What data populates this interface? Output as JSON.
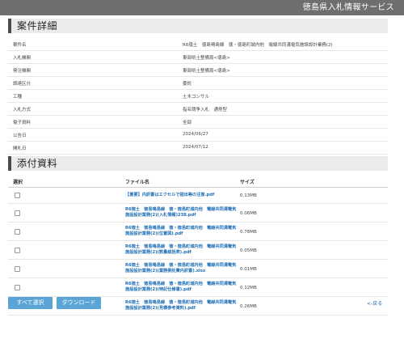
{
  "site": {
    "title": "徳島県入札情報サービス"
  },
  "details": {
    "heading": "案件詳細",
    "rows": [
      {
        "label": "案件名",
        "value": "R6徳土　徳島鳴島線　徳・徳島町城内他　電線共同溝電気施設設計業務(2)"
      },
      {
        "label": "入札機関",
        "value": "東部県土整備局<徳島>"
      },
      {
        "label": "発注機関",
        "value": "東部県土整備局<徳島>"
      },
      {
        "label": "調達区分",
        "value": "委託"
      },
      {
        "label": "工種",
        "value": "土木コンサル"
      },
      {
        "label": "入札方式",
        "value": "指名競争入札　通常型"
      },
      {
        "label": "電子資料",
        "value": "全部"
      },
      {
        "label": "公告日",
        "value": "2024/06/27"
      },
      {
        "label": "開札日",
        "value": "2024/07/12"
      }
    ]
  },
  "attachments": {
    "heading": "添付資料",
    "columns": {
      "select": "選択",
      "filename": "ファイル名",
      "size": "サイズ"
    },
    "files": [
      {
        "name": "【重要】内訳書はエクセルで提出等の注意.pdf",
        "size": "0.13MB"
      },
      {
        "name": "R6徳土　徳島鳴島線　徳・徳島町城内他　電線共同溝電気施設設計業務(2)(入札情報)238.pdf",
        "size": "0.06MB"
      },
      {
        "name": "R6徳土　徳島鳴島線　徳・徳島町城内他　電線共同溝電気施設設計業務(2)(位置図).pdf",
        "size": "0.78MB"
      },
      {
        "name": "R6徳土　徳島鳴島線　徳・徳島町城内他　電線共同溝電気施設設計業務(2)(数量総括表).pdf",
        "size": "0.05MB"
      },
      {
        "name": "R6徳土　徳島鳴島線　徳・徳島町城内他　電線共同溝電気施設設計業務(2)(業務委託費内訳書).xlsx",
        "size": "0.01MB"
      },
      {
        "name": "R6徳土　徳島鳴島線　徳・徳島町城内他　電線共同溝電気施設設計業務(2)(特記仕様書).pdf",
        "size": "0.12MB"
      },
      {
        "name": "R6徳土　徳島鳴島線　徳・徳島町城内他　電線共同溝電気施設設計業務(2)(見積参考資料).pdf",
        "size": "0.26MB"
      }
    ]
  },
  "actions": {
    "select_all": "すべて選択",
    "download": "ダウンロード",
    "back": "<-戻る"
  }
}
